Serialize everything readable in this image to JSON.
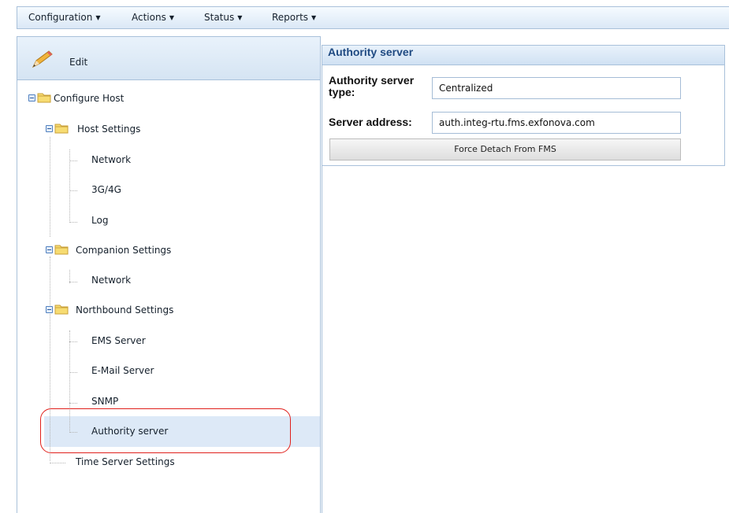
{
  "menubar": {
    "items": [
      {
        "label": "Configuration"
      },
      {
        "label": "Actions"
      },
      {
        "label": "Status"
      },
      {
        "label": "Reports"
      }
    ]
  },
  "toolbar": {
    "edit_label": "Edit"
  },
  "tree": {
    "configure_host": "Configure Host",
    "host_settings": "Host Settings",
    "host_network": "Network",
    "host_3g4g": "3G/4G",
    "host_log": "Log",
    "companion_settings": "Companion Settings",
    "companion_network": "Network",
    "northbound_settings": "Northbound Settings",
    "ems_server": "EMS Server",
    "email_server": "E-Mail Server",
    "snmp": "SNMP",
    "authority_server": "Authority server",
    "time_server_settings": "Time Server Settings",
    "selected": "Authority server"
  },
  "panel": {
    "title": "Authority server",
    "type_label_line1": "Authority server",
    "type_label_line2": "type:",
    "type_value": "Centralized",
    "address_label": "Server address:",
    "address_value": "auth.integ-rtu.fms.exfonova.com",
    "force_detach_label": "Force Detach From FMS"
  },
  "colors": {
    "accent": "#1f4a82",
    "selection": "#dde9f7",
    "annotation": "#e0201c"
  }
}
